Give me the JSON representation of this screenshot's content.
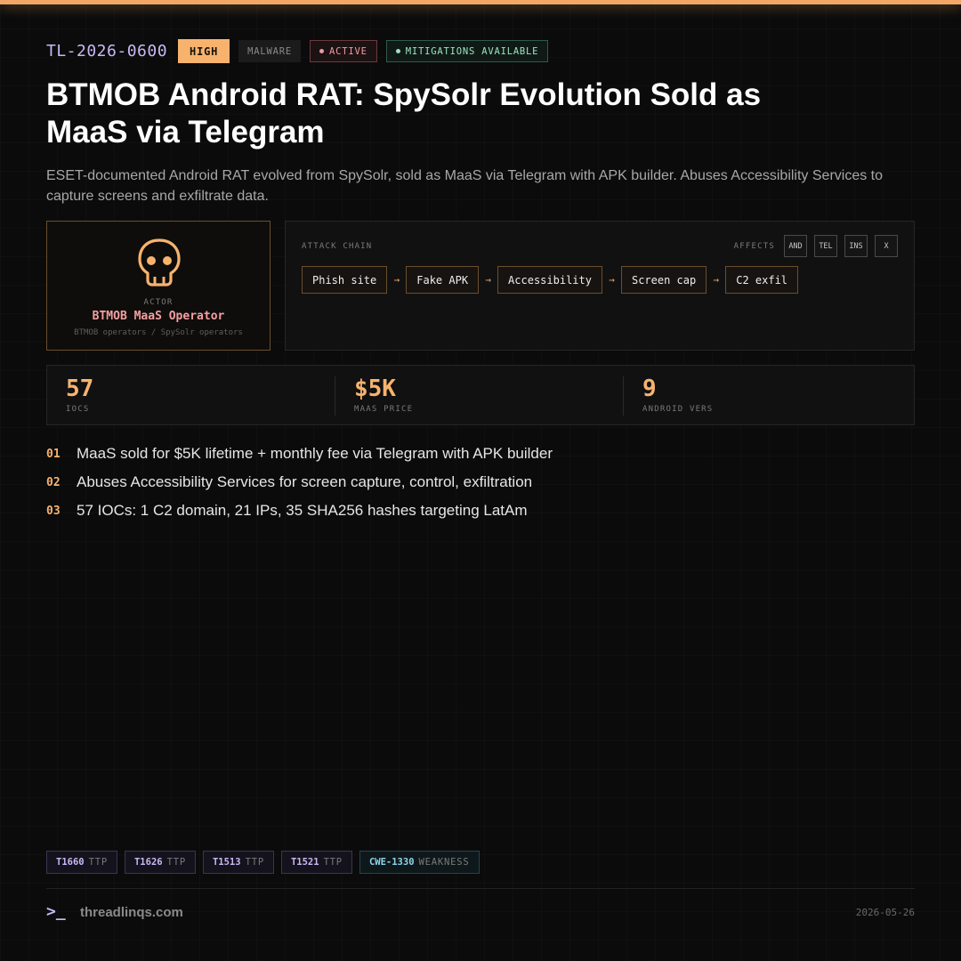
{
  "header": {
    "ticket_id": "TL-2026-0600",
    "severity": "HIGH",
    "category": "MALWARE",
    "status": "ACTIVE",
    "mitigation": "MITIGATIONS AVAILABLE",
    "colors": {
      "accent": "#f7b36e",
      "id": "#c9b8f5",
      "active": "#f09aa0",
      "mitigation": "#9ee2c4"
    }
  },
  "title": "BTMOB Android RAT: SpySolr Evolution Sold as MaaS via Telegram",
  "summary": "ESET-documented Android RAT evolved from SpySolr, sold as MaaS via Telegram with APK builder. Abuses Accessibility Services to capture screens and exfiltrate data.",
  "actor": {
    "icon": "skull-icon",
    "label": "ACTOR",
    "name": "BTMOB MaaS Operator",
    "aliases": "BTMOB operators / SpySolr operators"
  },
  "attack_chain": {
    "label": "ATTACK CHAIN",
    "affects_label": "AFFECTS",
    "platforms": [
      "AND",
      "TEL",
      "INS",
      "X"
    ],
    "steps": [
      "Phish site",
      "Fake APK",
      "Accessibility",
      "Screen cap",
      "C2 exfil"
    ],
    "arrow": "→"
  },
  "stats": [
    {
      "value": "57",
      "label": "IOCS"
    },
    {
      "value": "$5K",
      "label": "MAAS PRICE"
    },
    {
      "value": "9",
      "label": "ANDROID VERS"
    }
  ],
  "findings": [
    {
      "num": "01",
      "text": "MaaS sold for $5K lifetime + monthly fee via Telegram with APK builder"
    },
    {
      "num": "02",
      "text": "Abuses Accessibility Services for screen capture, control, exfiltration"
    },
    {
      "num": "03",
      "text": "57 IOCs: 1 C2 domain, 21 IPs, 35 SHA256 hashes targeting LatAm"
    }
  ],
  "tags": [
    {
      "id": "T1660",
      "kind": "TTP"
    },
    {
      "id": "T1626",
      "kind": "TTP"
    },
    {
      "id": "T1513",
      "kind": "TTP"
    },
    {
      "id": "T1521",
      "kind": "TTP"
    },
    {
      "id": "CWE-1330",
      "kind": "WEAKNESS"
    }
  ],
  "footer": {
    "prompt": ">_",
    "site": "threadlinqs.com",
    "date": "2026-05-26"
  }
}
